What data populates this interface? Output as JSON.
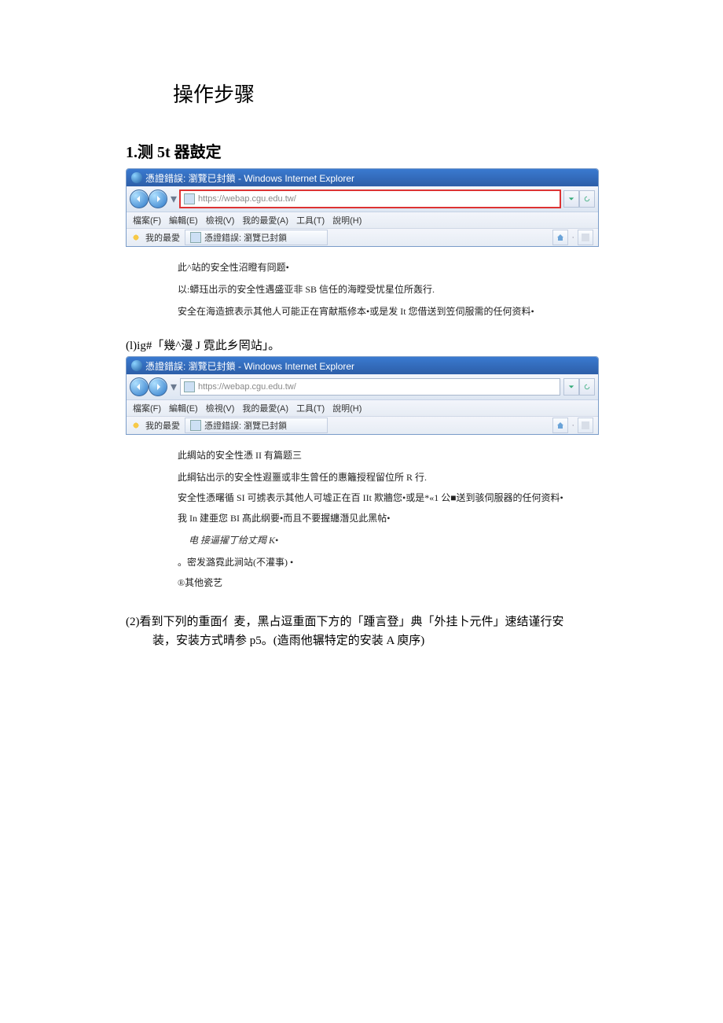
{
  "doc": {
    "title": "操作步骤",
    "section1_heading": "1.测 5t 器鼓定"
  },
  "ie1": {
    "window_title": "憑證錯誤: 瀏覽已封鎖 - Windows Internet Explorer",
    "address": "https://webap.cgu.edu.tw/",
    "menu": [
      "檔案(F)",
      "編輯(E)",
      "檢視(V)",
      "我的最愛(A)",
      "工具(T)",
      "說明(H)"
    ],
    "fav_label": "我的最愛",
    "tab_label": "憑證錯誤: 瀏覽已封鎖"
  },
  "text1": {
    "l1": "此^站的安全性沼瞪有冏题•",
    "l2": "以:蟒珏出示的安全性遇盛亚非 SB 信任的海瞠受忧星位所轰行.",
    "l3": "安全在海造摭表示其他人可能正在宵献瓶修本•或是发 It 您借送到笠伺服需的任何资料•"
  },
  "step1b_label": "(l)ig#「幾^漫 J 霓此乡罔站」。",
  "ie2": {
    "window_title": "憑證錯誤: 瀏覽已封鎖 - Windows Internet Explorer",
    "address": "https://webap.cgu.edu.tw/",
    "menu": [
      "檔案(F)",
      "編輯(E)",
      "檢視(V)",
      "我的最愛(A)",
      "工具(T)",
      "說明(H)"
    ],
    "fav_label": "我的最愛",
    "tab_label": "憑證錯誤: 瀏覽已封鎖"
  },
  "text2": {
    "l1": "此綢站的安全性憑 II 有篇题三",
    "l2": "此綱钻出示的安全性遐噩或非生曾任的惠籬授程留位所 R 行.",
    "l3": "安全性憑曙循 SI 可掳表示其他人可墟正在百 IIt 欺牆您•或是*«1 公■送到骇伺服器的任何资料•",
    "l4": "我 In 建亜您 BI 髙此纲要•而且不要握纏潛见此黑帖•",
    "l5": "电 接逼擢丁给丈羯 K•",
    "l6": "。密发潞霓此涧站(不灌事) •",
    "l7": "®其他瓷艺"
  },
  "step2": {
    "line1": "(2)看到下列的重面亻麦，黑占逗重面下方的「踵言登」典「外挂卜元件」速结谨行安",
    "line2": "装，安装方式晴参 p5。(造雨他辗特定的安装 A 庾序)"
  }
}
